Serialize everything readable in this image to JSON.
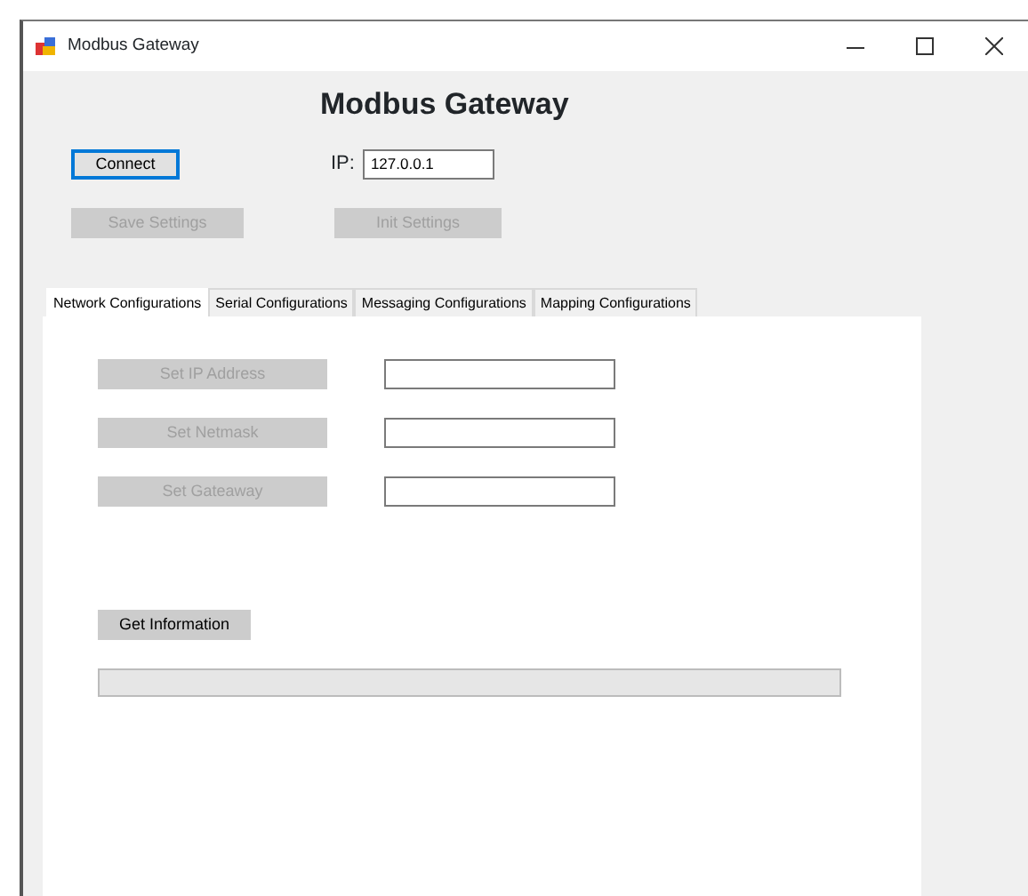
{
  "window": {
    "title": "Modbus Gateway"
  },
  "heading": "Modbus Gateway",
  "connect_button": {
    "label": "Connect",
    "disabled": false
  },
  "ip": {
    "label": "IP:",
    "value": "127.0.0.1"
  },
  "settings_buttons": [
    {
      "label": "Save Settings",
      "disabled": true
    },
    {
      "label": "Init Settings",
      "disabled": true
    }
  ],
  "tabs": [
    {
      "label": "Network Configurations",
      "selected": true
    },
    {
      "label": "Serial Configurations",
      "selected": false
    },
    {
      "label": "Messaging Configurations",
      "selected": false
    },
    {
      "label": "Mapping Configurations",
      "selected": false
    }
  ],
  "network_rows": [
    {
      "button": "Set IP Address",
      "disabled": true
    },
    {
      "button": "Set Netmask",
      "disabled": true
    },
    {
      "button": "Set Gateaway",
      "disabled": true
    }
  ],
  "info_button": {
    "label": "Get Information",
    "disabled": false
  },
  "progress": {
    "level": 0
  }
}
